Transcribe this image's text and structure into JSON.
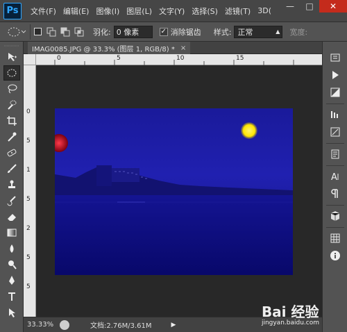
{
  "app": {
    "logo": "Ps"
  },
  "menu": [
    "文件(F)",
    "编辑(E)",
    "图像(I)",
    "图层(L)",
    "文字(Y)",
    "选择(S)",
    "滤镜(T)",
    "3D("
  ],
  "window_controls": {
    "minimize": "—",
    "maximize": "□",
    "close": "✕"
  },
  "options": {
    "feather_label": "羽化:",
    "feather_value": "0 像素",
    "antialias_label": "消除锯齿",
    "antialias_checked": true,
    "style_label": "样式:",
    "style_value": "正常",
    "width_label": "宽度:"
  },
  "document": {
    "tab_title": "IMAG0085.JPG @ 33.3% (图层 1, RGB/8) *",
    "close": "×"
  },
  "rulers": {
    "h_ticks": [
      "0",
      "5",
      "10",
      "15"
    ],
    "v_ticks": [
      "0",
      "5",
      "1",
      "5",
      "2",
      "5",
      "5"
    ]
  },
  "status": {
    "zoom": "33.33%",
    "doc_info": "文档:2.76M/3.61M",
    "arrow": "▶"
  },
  "left_tools": [
    "move-tool-icon",
    "elliptical-marquee-icon",
    "lasso-icon",
    "quick-select-icon",
    "crop-icon",
    "eyedropper-icon",
    "healing-brush-icon",
    "brush-icon",
    "clone-stamp-icon",
    "history-brush-icon",
    "eraser-icon",
    "gradient-icon",
    "blur-icon",
    "dodge-icon",
    "pen-icon",
    "type-icon",
    "path-select-icon"
  ],
  "right_icons": [
    "history-panel-icon",
    "actions-panel-icon",
    "adjustments-panel-icon",
    "layer-comps-icon",
    "brush-panel-icon",
    "clone-source-icon",
    "character-panel-icon",
    "paragraph-panel-icon",
    "3d-panel-icon",
    "swatches-panel-icon",
    "info-panel-icon"
  ],
  "watermark": {
    "brand": "Bai 经验",
    "url": "jingyan.baidu.com"
  },
  "colors": {
    "sky": "#1a1a9a",
    "moon": "#ffe600",
    "ui_dark": "#282828"
  }
}
